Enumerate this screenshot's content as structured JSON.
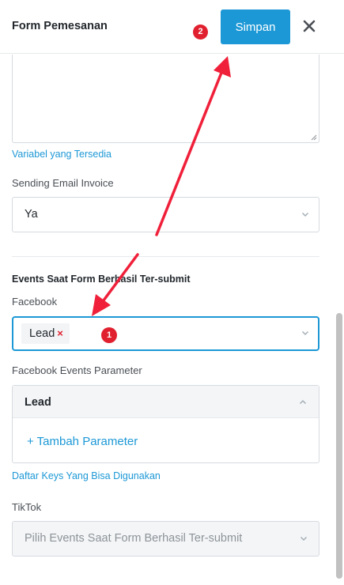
{
  "header": {
    "title": "Form Pemesanan",
    "step_badge": "2",
    "save_label": "Simpan",
    "close_icon": "close-icon"
  },
  "form": {
    "variables_link": "Variabel yang Tersedia",
    "email_invoice": {
      "label": "Sending Email Invoice",
      "value": "Ya"
    },
    "events_title": "Events Saat Form Berhasil Ter-submit",
    "facebook": {
      "label": "Facebook",
      "tag": "Lead",
      "tag_remove": "×",
      "step_badge": "1"
    },
    "fb_params": {
      "label": "Facebook Events Parameter",
      "header": "Lead",
      "add_label": "+ Tambah Parameter",
      "keys_link": "Daftar Keys Yang Bisa Digunakan"
    },
    "tiktok": {
      "label": "TikTok",
      "placeholder": "Pilih Events Saat Form Berhasil Ter-submit"
    }
  },
  "colors": {
    "accent": "#1c98d6",
    "badge": "#e1202f",
    "arrow": "#f0203a"
  }
}
